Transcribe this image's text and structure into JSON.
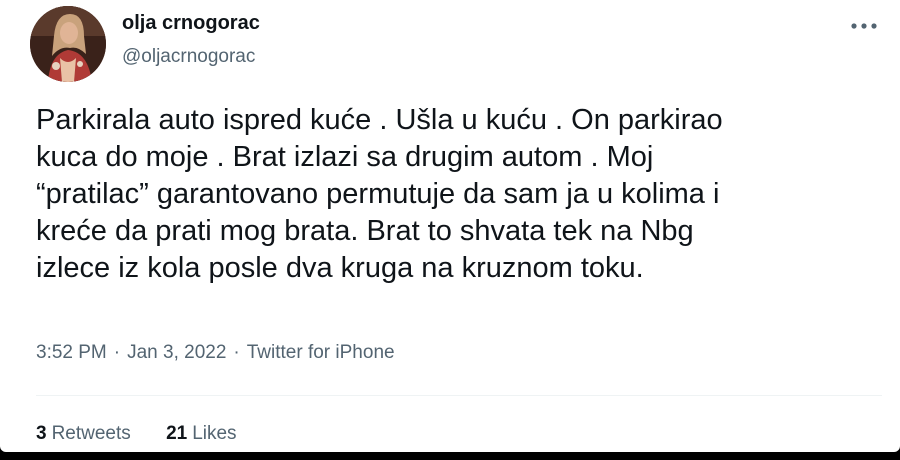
{
  "author": {
    "display_name": "olja crnogorac",
    "handle": "@oljacrnogorac",
    "avatar": "profile-photo"
  },
  "more_icon": "more-horizontal-icon",
  "tweet": {
    "lines": [
      "Parkirala auto ispred kuće . Ušla u kuću . On parkirao",
      "kuca do moje . Brat izlazi sa drugim autom . Moj",
      "“pratilac” garantovano permutuje da sam ja u kolima i",
      "kreće da prati mog brata. Brat to shvata tek na Nbg",
      "izlece iz kola posle dva kruga na kruznom toku."
    ]
  },
  "meta": {
    "time": "3:52 PM",
    "separator": "·",
    "date": "Jan 3, 2022",
    "source": "Twitter for iPhone"
  },
  "stats": {
    "retweets_count": "3",
    "retweets_label": "Retweets",
    "likes_count": "21",
    "likes_label": "Likes"
  },
  "colors": {
    "text_primary": "#0f1419",
    "text_secondary": "#536471",
    "divider": "#eff3f4",
    "background": "#ffffff"
  }
}
